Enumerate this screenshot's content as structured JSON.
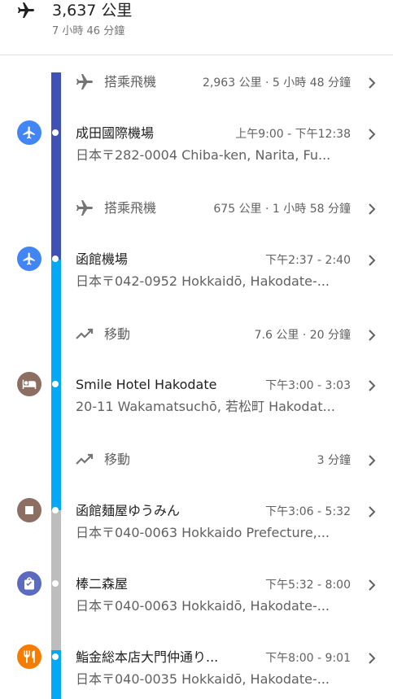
{
  "header": {
    "distance": "3,637 公里",
    "duration": "7 小時 46 分鐘",
    "icon": "airplane-icon"
  },
  "colors": {
    "dark_blue": "#3f51b5",
    "light_blue": "#03a9f4",
    "gray": "#bdbdbd",
    "blue_circle": "#4285f4",
    "brown_circle": "#8d6e63",
    "purple_circle": "#5c6bc0",
    "orange_circle": "#f57c00"
  },
  "items": [
    {
      "kind": "travel",
      "icon": "airplane-icon",
      "label": "搭乘飛機",
      "info": "2,963 公里 · 5 小時 48 分鐘"
    },
    {
      "kind": "place",
      "icon": "airport-icon",
      "name": "成田國際機場",
      "time": "上午9:00 - 下午12:38",
      "address": "日本〒282-0004 Chiba-ken, Narita, Fu..."
    },
    {
      "kind": "travel",
      "icon": "airplane-icon",
      "label": "搭乘飛機",
      "info": "675 公里 · 1 小時 58 分鐘"
    },
    {
      "kind": "place",
      "icon": "airport-icon",
      "name": "函館機場",
      "time": "下午2:37 - 2:40",
      "address": "日本〒042-0952 Hokkaidō, Hakodate-..."
    },
    {
      "kind": "travel",
      "icon": "route-icon",
      "label": "移動",
      "info": "7.6 公里 · 20 分鐘"
    },
    {
      "kind": "place",
      "icon": "hotel-icon",
      "name": "Smile Hotel Hakodate",
      "time": "下午3:00 - 3:03",
      "address": "20-11 Wakamatsuchō, 若松町 Hakodat..."
    },
    {
      "kind": "travel",
      "icon": "route-icon",
      "label": "移動",
      "info": "3 分鐘"
    },
    {
      "kind": "place",
      "icon": "stop-icon",
      "name": "函館麺屋ゆうみん",
      "time": "下午3:06 - 5:32",
      "address": "日本〒040-0063 Hokkaido Prefecture,..."
    },
    {
      "kind": "place",
      "icon": "shopping-bag-icon",
      "name": "棒二森屋",
      "time": "下午5:32 - 8:00",
      "address": "日本〒040-0063 Hokkaidō, Hakodate-..."
    },
    {
      "kind": "place",
      "icon": "restaurant-icon",
      "name": "鮨金総本店大門仲通り...",
      "time": "下午8:00 - 9:01",
      "address": "日本〒040-0035 Hokkaidō, Hakodate-..."
    }
  ]
}
